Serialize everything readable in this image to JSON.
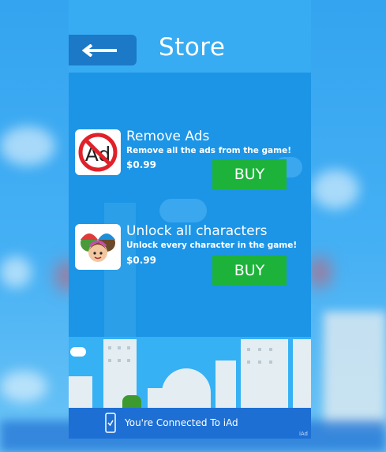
{
  "header": {
    "title": "Store",
    "back_icon": "arrow-left-icon"
  },
  "items": [
    {
      "title": "Remove Ads",
      "description": "Remove all the ads from the game!",
      "price": "$0.99",
      "buy_label": "BUY",
      "icon_text": "Ad",
      "icon": "no-ads-icon"
    },
    {
      "title": "Unlock all characters",
      "description": "Unlock every character in the game!",
      "price": "$0.99",
      "buy_label": "BUY",
      "icon": "characters-icon"
    }
  ],
  "ad_banner": {
    "text": "You're Connected To iAd",
    "badge": "iAd",
    "icon": "phone-check-icon"
  },
  "colors": {
    "panel": "#1c95e6",
    "buy": "#1db33a",
    "banner": "#1d6fd4"
  }
}
